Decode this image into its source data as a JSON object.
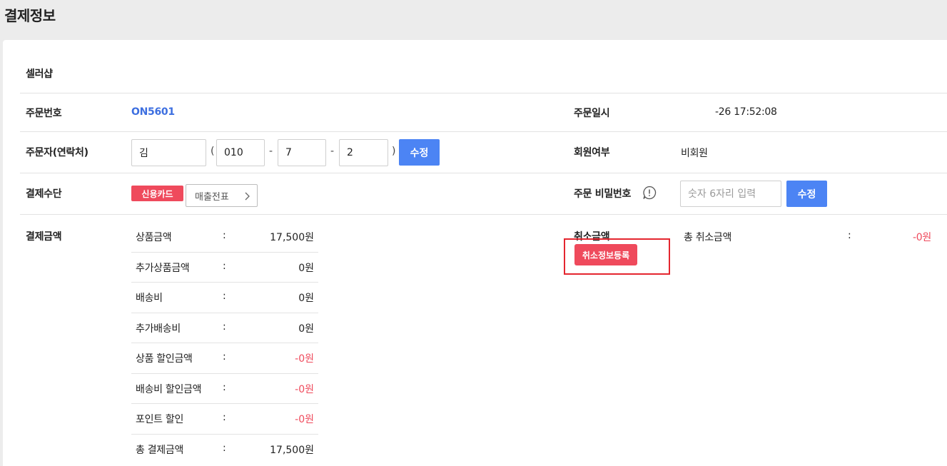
{
  "page_title": "결제정보",
  "seller": {
    "name": "셀러샵"
  },
  "order_number": {
    "label": "주문번호",
    "value": "ON5601"
  },
  "order_datetime": {
    "label": "주문일시",
    "value": "-26 17:52:08"
  },
  "orderer": {
    "label": "주문자(연락처)",
    "name_value": "김",
    "open_paren": "(",
    "phone1": "010",
    "dash1": "-",
    "phone2": "7",
    "dash2": "-",
    "phone3": "2",
    "close_paren": ")",
    "edit_label": "수정"
  },
  "membership": {
    "label": "회원여부",
    "value": "비회원"
  },
  "payment_method": {
    "label": "결제수단",
    "badge": "신용카드",
    "receipt_button": "매출전표"
  },
  "order_password": {
    "label": "주문 비밀번호",
    "placeholder": "숫자 6자리 입력",
    "edit_label": "수정",
    "info_icon": "info-circle-icon"
  },
  "payment_amount": {
    "label": "결제금액",
    "rows": [
      {
        "name": "상품금액",
        "colon": ":",
        "value": "17,500원",
        "negative": false
      },
      {
        "name": "추가상품금액",
        "colon": ":",
        "value": "0원",
        "negative": false
      },
      {
        "name": "배송비",
        "colon": ":",
        "value": "0원",
        "negative": false
      },
      {
        "name": "추가배송비",
        "colon": ":",
        "value": "0원",
        "negative": false
      },
      {
        "name": "상품 할인금액",
        "colon": ":",
        "value": "-0원",
        "negative": true
      },
      {
        "name": "배송비 할인금액",
        "colon": ":",
        "value": "-0원",
        "negative": true
      },
      {
        "name": "포인트 할인",
        "colon": ":",
        "value": "-0원",
        "negative": true
      },
      {
        "name": "총 결제금액",
        "colon": ":",
        "value": "17,500원",
        "negative": false
      }
    ]
  },
  "cancel_amount": {
    "label": "취소금액",
    "register_button": "취소정보등록",
    "total_label": "총 취소금액",
    "colon": ":",
    "total_value": "-0원"
  },
  "colors": {
    "accent_blue": "#4c84f4",
    "link_blue": "#3d6fe0",
    "badge_red": "#ef4a5c",
    "highlight_red": "#e4262f"
  }
}
